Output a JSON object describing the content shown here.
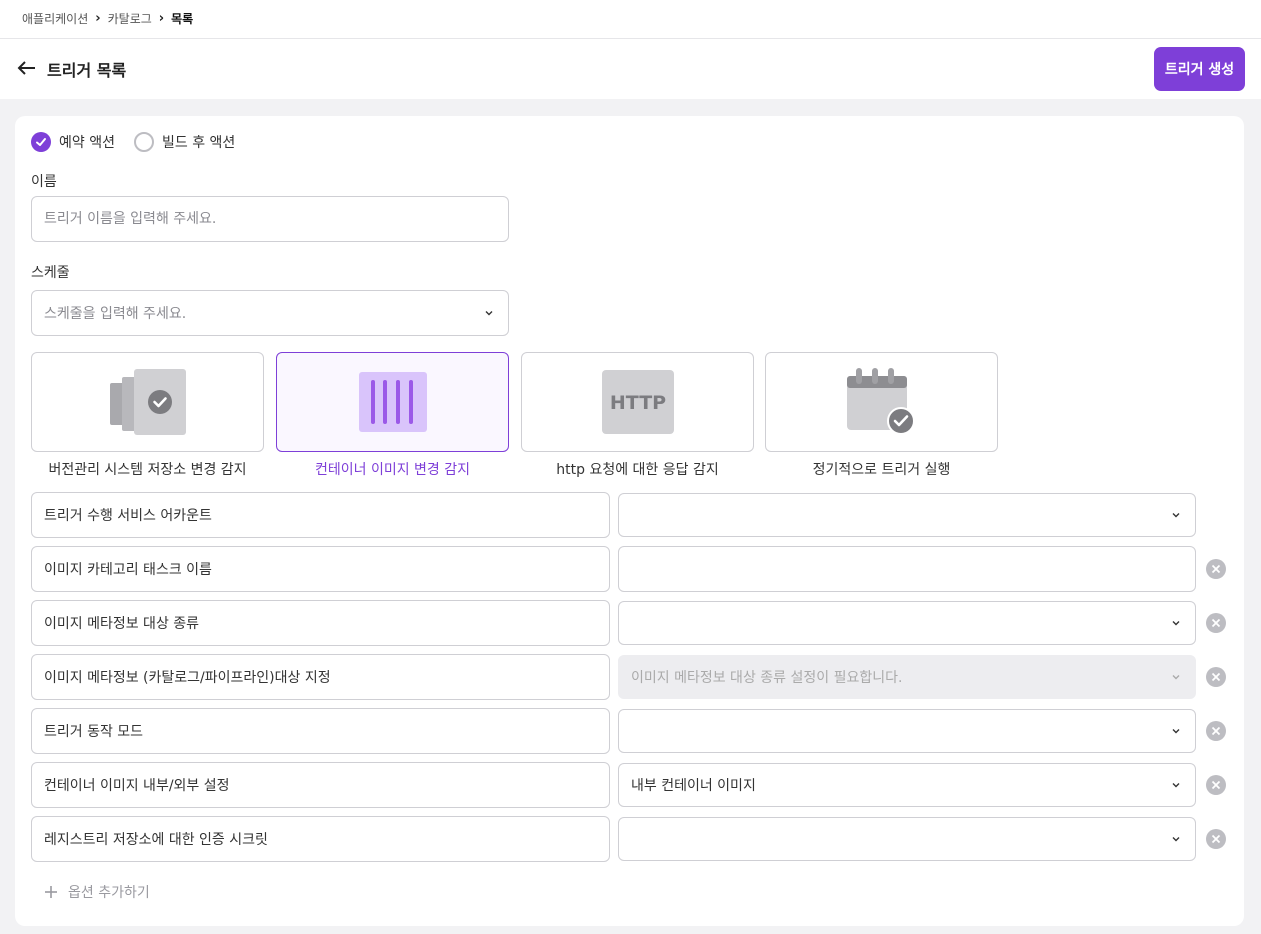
{
  "breadcrumb": {
    "items": [
      "애플리케이션",
      "카탈로그"
    ],
    "current": "목록"
  },
  "header": {
    "title": "트리거 목록",
    "create_button": "트리거 생성"
  },
  "action_type": {
    "options": [
      {
        "label": "예약 액션",
        "checked": true
      },
      {
        "label": "빌드 후 액션",
        "checked": false
      }
    ]
  },
  "name_field": {
    "label": "이름",
    "placeholder": "트리거 이름을 입력해 주세요."
  },
  "schedule_field": {
    "label": "스케줄",
    "placeholder": "스케줄을 입력해 주세요."
  },
  "trigger_types": [
    {
      "label": "버전관리 시스템 저장소 변경 감지",
      "icon": "repository-check-icon",
      "selected": false
    },
    {
      "label": "컨테이너 이미지 변경 감지",
      "icon": "container-image-icon",
      "selected": true
    },
    {
      "label": "http 요청에 대한 응답 감지",
      "icon": "http-icon",
      "icon_text": "HTTP",
      "selected": false
    },
    {
      "label": "정기적으로 트리거 실행",
      "icon": "calendar-check-icon",
      "selected": false
    }
  ],
  "options": [
    {
      "label": "트리거 수행 서비스 어카운트",
      "value": "",
      "control": "select",
      "removable": false
    },
    {
      "label": "이미지 카테고리 태스크 이름",
      "value": "",
      "control": "input",
      "removable": true
    },
    {
      "label": "이미지 메타정보 대상 종류",
      "value": "",
      "control": "select",
      "removable": true
    },
    {
      "label": "이미지 메타정보 (카탈로그/파이프라인)대상 지정",
      "value": "이미지 메타정보 대상 종류 설정이 필요합니다.",
      "control": "select",
      "disabled": true,
      "removable": true
    },
    {
      "label": "트리거 동작 모드",
      "value": "",
      "control": "select",
      "removable": true
    },
    {
      "label": "컨테이너 이미지 내부/외부 설정",
      "value": "내부 컨테이너 이미지",
      "control": "select",
      "removable": true
    },
    {
      "label": "레지스트리 저장소에 대한 인증 시크릿",
      "value": "",
      "control": "select",
      "removable": true
    }
  ],
  "add_option": {
    "label": "옵션 추가하기"
  },
  "colors": {
    "accent": "#7e3fd8",
    "border": "#cfcfd4",
    "background": "#f2f2f4",
    "icon_gray": "#c8c8cc",
    "remove_gray": "#bdbdc2"
  }
}
